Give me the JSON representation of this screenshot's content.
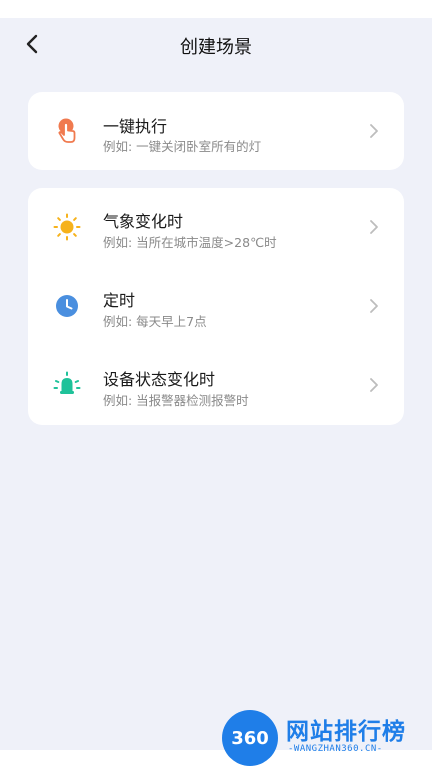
{
  "header": {
    "title": "创建场景"
  },
  "card_one": {
    "items": [
      {
        "title": "一键执行",
        "subtitle": "例如: 一键关闭卧室所有的灯",
        "icon": "hand-tap-icon",
        "icon_color": "#f07a4f"
      }
    ]
  },
  "card_two": {
    "items": [
      {
        "title": "气象变化时",
        "subtitle": "例如: 当所在城市温度>28℃时",
        "icon": "sun-icon",
        "icon_color": "#f6b21b"
      },
      {
        "title": "定时",
        "subtitle": "例如: 每天早上7点",
        "icon": "clock-icon",
        "icon_color": "#4a8fdf"
      },
      {
        "title": "设备状态变化时",
        "subtitle": "例如: 当报警器检测报警时",
        "icon": "alarm-bulb-icon",
        "icon_color": "#1fc29a"
      }
    ]
  },
  "watermark": {
    "badge": "360",
    "text": "网站排行榜",
    "sub": "-WANGZHAN360.CN-",
    "color": "#1f7ee8"
  }
}
